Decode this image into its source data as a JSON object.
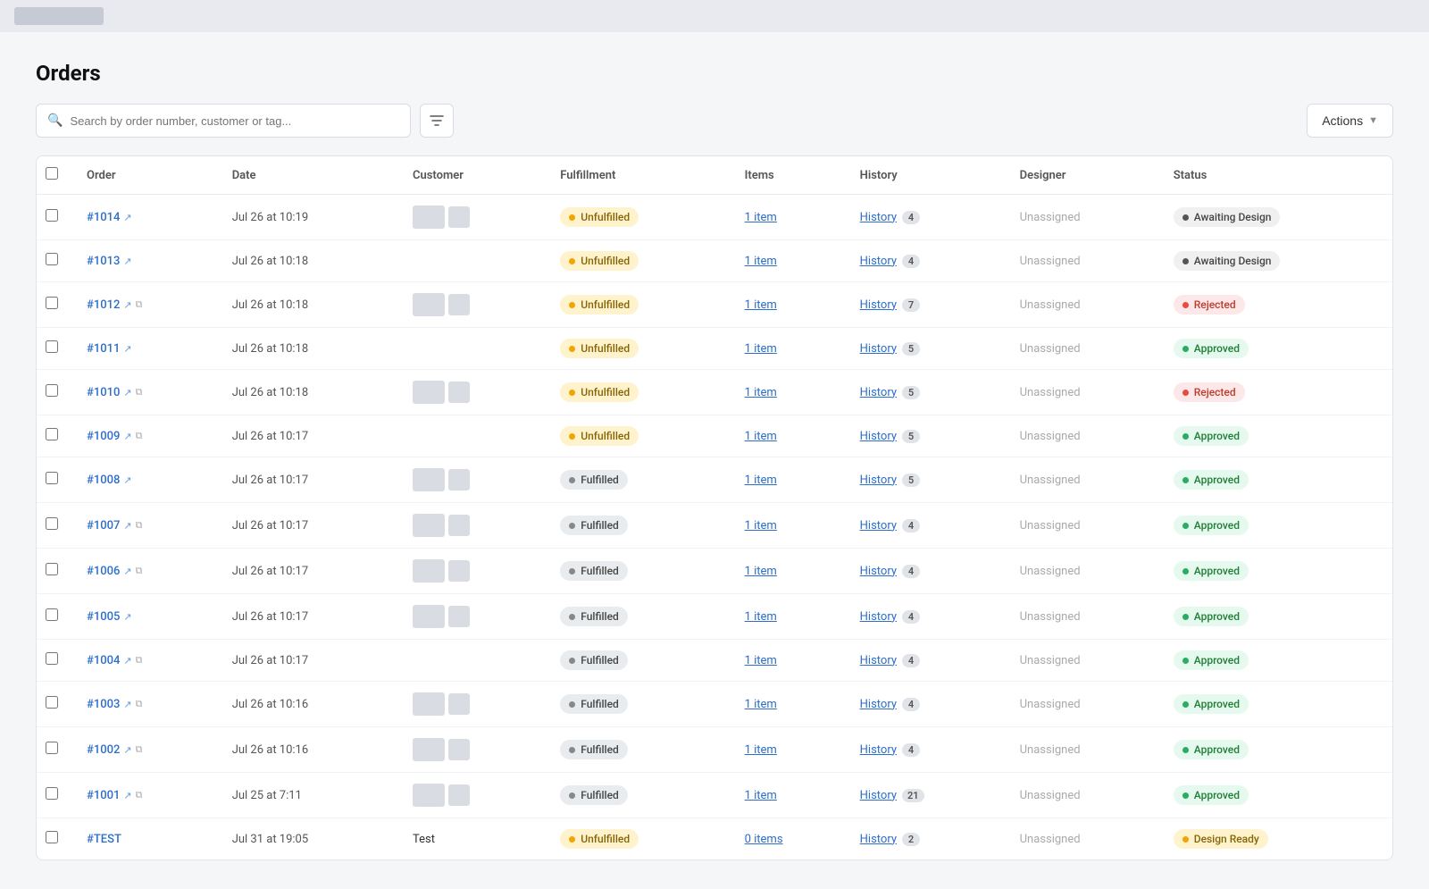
{
  "topbar": {
    "logo_label": ""
  },
  "page": {
    "title": "Orders"
  },
  "toolbar": {
    "search_placeholder": "Search by order number, customer or tag...",
    "actions_label": "Actions"
  },
  "table": {
    "columns": [
      "",
      "Order",
      "Date",
      "Customer",
      "Fulfillment",
      "Items",
      "History",
      "Designer",
      "Status"
    ],
    "rows": [
      {
        "order": "#1014",
        "has_ext": true,
        "has_copy": false,
        "date": "Jul 26 at 10:19",
        "has_customer_img": true,
        "fulfillment": "Unfulfilled",
        "fulfillment_type": "unfulfilled",
        "items_label": "1 item",
        "history_label": "History",
        "history_count": "4",
        "designer": "Unassigned",
        "status": "Awaiting Design",
        "status_type": "awaiting"
      },
      {
        "order": "#1013",
        "has_ext": true,
        "has_copy": false,
        "date": "Jul 26 at 10:18",
        "has_customer_img": false,
        "fulfillment": "Unfulfilled",
        "fulfillment_type": "unfulfilled",
        "items_label": "1 item",
        "history_label": "History",
        "history_count": "4",
        "designer": "Unassigned",
        "status": "Awaiting Design",
        "status_type": "awaiting"
      },
      {
        "order": "#1012",
        "has_ext": true,
        "has_copy": true,
        "date": "Jul 26 at 10:18",
        "has_customer_img": true,
        "fulfillment": "Unfulfilled",
        "fulfillment_type": "unfulfilled",
        "items_label": "1 item",
        "history_label": "History",
        "history_count": "7",
        "designer": "Unassigned",
        "status": "Rejected",
        "status_type": "rejected"
      },
      {
        "order": "#1011",
        "has_ext": true,
        "has_copy": false,
        "date": "Jul 26 at 10:18",
        "has_customer_img": false,
        "fulfillment": "Unfulfilled",
        "fulfillment_type": "unfulfilled",
        "items_label": "1 item",
        "history_label": "History",
        "history_count": "5",
        "designer": "Unassigned",
        "status": "Approved",
        "status_type": "approved"
      },
      {
        "order": "#1010",
        "has_ext": true,
        "has_copy": true,
        "date": "Jul 26 at 10:18",
        "has_customer_img": true,
        "fulfillment": "Unfulfilled",
        "fulfillment_type": "unfulfilled",
        "items_label": "1 item",
        "history_label": "History",
        "history_count": "5",
        "designer": "Unassigned",
        "status": "Rejected",
        "status_type": "rejected"
      },
      {
        "order": "#1009",
        "has_ext": true,
        "has_copy": true,
        "date": "Jul 26 at 10:17",
        "has_customer_img": false,
        "fulfillment": "Unfulfilled",
        "fulfillment_type": "unfulfilled",
        "items_label": "1 item",
        "history_label": "History",
        "history_count": "5",
        "designer": "Unassigned",
        "status": "Approved",
        "status_type": "approved"
      },
      {
        "order": "#1008",
        "has_ext": true,
        "has_copy": false,
        "date": "Jul 26 at 10:17",
        "has_customer_img": true,
        "fulfillment": "Fulfilled",
        "fulfillment_type": "fulfilled",
        "items_label": "1 item",
        "history_label": "History",
        "history_count": "5",
        "designer": "Unassigned",
        "status": "Approved",
        "status_type": "approved"
      },
      {
        "order": "#1007",
        "has_ext": true,
        "has_copy": true,
        "date": "Jul 26 at 10:17",
        "has_customer_img": true,
        "fulfillment": "Fulfilled",
        "fulfillment_type": "fulfilled",
        "items_label": "1 item",
        "history_label": "History",
        "history_count": "4",
        "designer": "Unassigned",
        "status": "Approved",
        "status_type": "approved"
      },
      {
        "order": "#1006",
        "has_ext": true,
        "has_copy": true,
        "date": "Jul 26 at 10:17",
        "has_customer_img": true,
        "fulfillment": "Fulfilled",
        "fulfillment_type": "fulfilled",
        "items_label": "1 item",
        "history_label": "History",
        "history_count": "4",
        "designer": "Unassigned",
        "status": "Approved",
        "status_type": "approved"
      },
      {
        "order": "#1005",
        "has_ext": true,
        "has_copy": false,
        "date": "Jul 26 at 10:17",
        "has_customer_img": true,
        "fulfillment": "Fulfilled",
        "fulfillment_type": "fulfilled",
        "items_label": "1 item",
        "history_label": "History",
        "history_count": "4",
        "designer": "Unassigned",
        "status": "Approved",
        "status_type": "approved"
      },
      {
        "order": "#1004",
        "has_ext": true,
        "has_copy": true,
        "date": "Jul 26 at 10:17",
        "has_customer_img": false,
        "fulfillment": "Fulfilled",
        "fulfillment_type": "fulfilled",
        "items_label": "1 item",
        "history_label": "History",
        "history_count": "4",
        "designer": "Unassigned",
        "status": "Approved",
        "status_type": "approved"
      },
      {
        "order": "#1003",
        "has_ext": true,
        "has_copy": true,
        "date": "Jul 26 at 10:16",
        "has_customer_img": true,
        "fulfillment": "Fulfilled",
        "fulfillment_type": "fulfilled",
        "items_label": "1 item",
        "history_label": "History",
        "history_count": "4",
        "designer": "Unassigned",
        "status": "Approved",
        "status_type": "approved"
      },
      {
        "order": "#1002",
        "has_ext": true,
        "has_copy": true,
        "date": "Jul 26 at 10:16",
        "has_customer_img": true,
        "fulfillment": "Fulfilled",
        "fulfillment_type": "fulfilled",
        "items_label": "1 item",
        "history_label": "History",
        "history_count": "4",
        "designer": "Unassigned",
        "status": "Approved",
        "status_type": "approved"
      },
      {
        "order": "#1001",
        "has_ext": true,
        "has_copy": true,
        "date": "Jul 25 at 7:11",
        "has_customer_img": true,
        "fulfillment": "Fulfilled",
        "fulfillment_type": "fulfilled",
        "items_label": "1 item",
        "history_label": "History",
        "history_count": "21",
        "designer": "Unassigned",
        "status": "Approved",
        "status_type": "approved"
      },
      {
        "order": "#TEST",
        "has_ext": false,
        "has_copy": false,
        "date": "Jul 31 at 19:05",
        "has_customer_img": false,
        "customer_text": "Test",
        "fulfillment": "Unfulfilled",
        "fulfillment_type": "unfulfilled",
        "items_label": "0 items",
        "history_label": "History",
        "history_count": "2",
        "designer": "Unassigned",
        "status": "Design Ready",
        "status_type": "design-ready"
      }
    ]
  }
}
